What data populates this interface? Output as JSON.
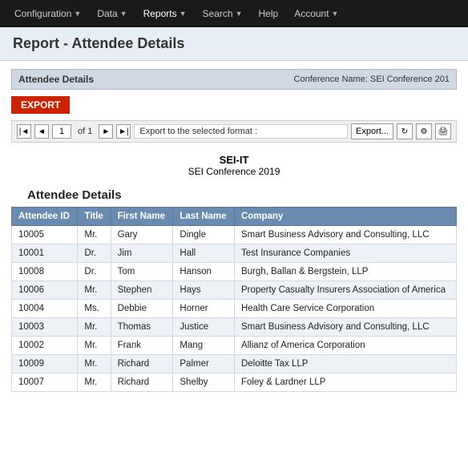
{
  "navbar": {
    "items": [
      {
        "label": "Configuration",
        "hasArrow": true
      },
      {
        "label": "Data",
        "hasArrow": true
      },
      {
        "label": "Reports",
        "hasArrow": true
      },
      {
        "label": "Search",
        "hasArrow": true
      },
      {
        "label": "Help",
        "hasArrow": false
      },
      {
        "label": "Account",
        "hasArrow": true
      }
    ]
  },
  "page": {
    "title": "Report - Attendee Details"
  },
  "panel": {
    "title": "Attendee Details",
    "conference_label": "Conference Name:",
    "conference_name": "SEI Conference 201"
  },
  "toolbar": {
    "export_label": "EXPORT",
    "pagination": {
      "of_text": "of 1",
      "page_value": "1",
      "format_label": "Export to the selected format :"
    },
    "export_button_label": "Export..."
  },
  "report": {
    "org_name": "SEI-IT",
    "conf_name": "SEI Conference 2019",
    "section_title": "Attendee Details",
    "table": {
      "headers": [
        "Attendee ID",
        "Title",
        "First Name",
        "Last Name",
        "Company"
      ],
      "rows": [
        {
          "id": "10005",
          "title": "Mr.",
          "first": "Gary",
          "last": "Dingle",
          "company": "Smart Business Advisory and Consulting, LLC"
        },
        {
          "id": "10001",
          "title": "Dr.",
          "first": "Jim",
          "last": "Hall",
          "company": "Test Insurance Companies"
        },
        {
          "id": "10008",
          "title": "Dr.",
          "first": "Tom",
          "last": "Hanson",
          "company": "Burgh, Ballan & Bergstein, LLP"
        },
        {
          "id": "10006",
          "title": "Mr.",
          "first": "Stephen",
          "last": "Hays",
          "company": "Property Casualty Insurers Association of America"
        },
        {
          "id": "10004",
          "title": "Ms.",
          "first": "Debbie",
          "last": "Horner",
          "company": "Health Care Service Corporation"
        },
        {
          "id": "10003",
          "title": "Mr.",
          "first": "Thomas",
          "last": "Justice",
          "company": "Smart Business Advisory and Consulting, LLC"
        },
        {
          "id": "10002",
          "title": "Mr.",
          "first": "Frank",
          "last": "Mang",
          "company": "Allianz of America Corporation"
        },
        {
          "id": "10009",
          "title": "Mr.",
          "first": "Richard",
          "last": "Palmer",
          "company": "Deloitte Tax LLP"
        },
        {
          "id": "10007",
          "title": "Mr.",
          "first": "Richard",
          "last": "Shelby",
          "company": "Foley & Lardner LLP"
        }
      ]
    }
  }
}
